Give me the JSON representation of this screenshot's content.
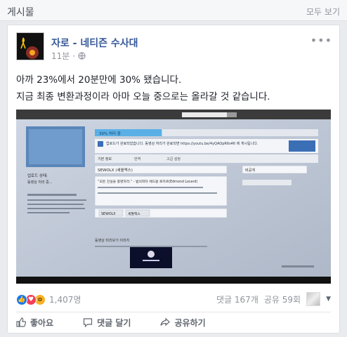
{
  "section": {
    "title": "게시물",
    "see_all": "모두 보기"
  },
  "post": {
    "page_name": "자로 - 네티즌 수사대",
    "time": "11분",
    "privacy_icon": "globe-icon",
    "more_icon": "ellipsis-icon",
    "lines": [
      "아까 23%에서 20분만에 30% 됐습니다.",
      "지금 최종 변환과정이라 아마 오늘 중으로는 올라갈 것 같습니다."
    ],
    "photo": {
      "progress_label": "30% 처리 중",
      "progress_fraction": 0.3,
      "notice": "업로드가 완료되었습니다. 동영상 처리가 완료되면 https://youtu.be/4yQAOpR6s46 에 게시됩니다.",
      "tabs": [
        "기본 정보",
        "번역",
        "고급 설정"
      ],
      "status_heading": "업로드 상태:",
      "status_text": "동영상 처리 중...",
      "title_value": "SEWOLX (세월엑스)",
      "desc_value": "“모든 진실을 증명하라.” - 법의학자 에드몽 로카르(Edmond Locard)",
      "tag1": "SEWOLX",
      "tag2": "세월엑스",
      "visibility": "비공개",
      "thumbnail_label": "동영상 미리보기 이미지"
    }
  },
  "stats": {
    "reaction_icons": [
      "like-icon",
      "love-icon",
      "wow-icon"
    ],
    "reaction_count": "1,407명",
    "comments": "댓글 167개",
    "shares": "공유 59회"
  },
  "actions": {
    "like": "좋아요",
    "comment": "댓글 달기",
    "share": "공유하기"
  },
  "colors": {
    "link": "#365899",
    "muted": "#90949c",
    "bg": "#e9ebee",
    "like": "#1877f2"
  }
}
